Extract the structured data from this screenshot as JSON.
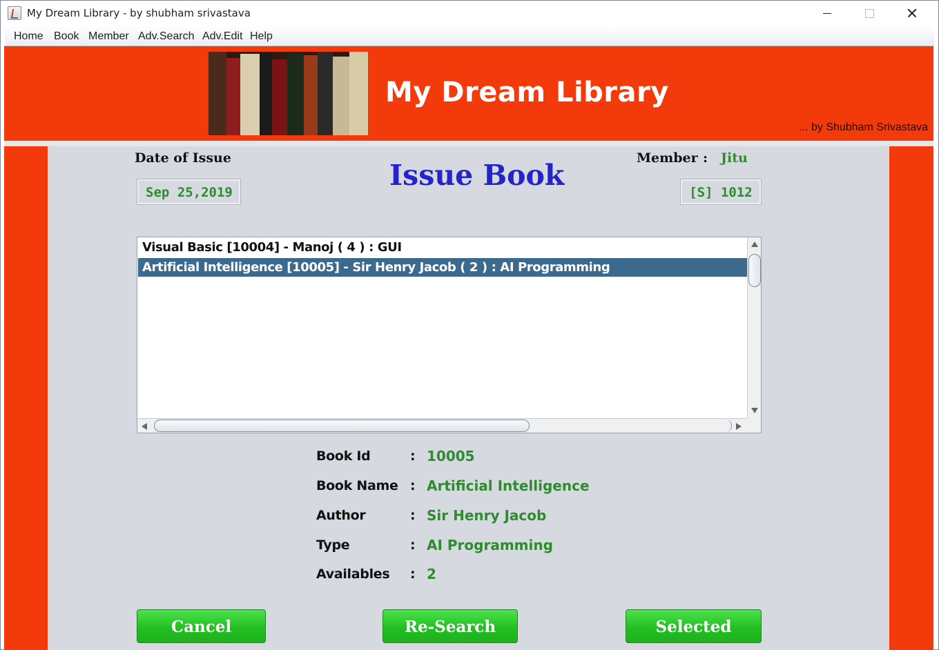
{
  "window": {
    "title": "My Dream Library - by shubham srivastava"
  },
  "menu": {
    "items": [
      "Home",
      "Book",
      "Member",
      "Adv.Search",
      "Adv.Edit",
      "Help"
    ]
  },
  "banner": {
    "title": "My Dream Library",
    "subtitle": "... by Shubham Srivastava",
    "accent_color": "#f23a0a"
  },
  "issue": {
    "page_title": "Issue Book",
    "date_label": "Date of Issue",
    "date_value": "Sep 25,2019",
    "member_label": "Member",
    "member_colon": ":",
    "member_name": "Jitu",
    "member_id": "[S] 1012"
  },
  "book_list": {
    "items": [
      "Visual Basic [10004] - Manoj ( 4 ) : GUI",
      "Artificial Intelligence [10005] - Sir Henry Jacob ( 2 ) : AI Programming"
    ],
    "selected_index": 1
  },
  "details": {
    "rows": [
      {
        "label": "Book Id",
        "colon": ":",
        "value": "10005"
      },
      {
        "label": "Book Name",
        "colon": ":",
        "value": "Artificial Intelligence"
      },
      {
        "label": "Author",
        "colon": ":",
        "value": "Sir Henry Jacob"
      },
      {
        "label": "Type",
        "colon": ":",
        "value": "AI Programming"
      },
      {
        "label": "Availables",
        "colon": ":",
        "value": "2"
      }
    ]
  },
  "buttons": {
    "cancel": "Cancel",
    "research": "Re-Search",
    "selected": "Selected"
  },
  "colors": {
    "value_green": "#2e8b2e",
    "title_blue": "#2424c8",
    "selection_blue": "#3c6a8e",
    "button_green": "#22c022"
  }
}
